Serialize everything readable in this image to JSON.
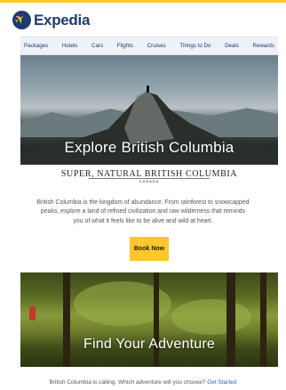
{
  "brand": {
    "name": "Expedia"
  },
  "nav": {
    "items": [
      "Packages",
      "Hotels",
      "Cars",
      "Flights",
      "Cruises",
      "Things to Do",
      "Deals",
      "Rewards"
    ]
  },
  "hero1": {
    "title": "Explore British Columbia"
  },
  "partner_logo": {
    "text": "SUPER, NATURAL BRITISH COLUMBIA",
    "subtext": "CANADA"
  },
  "body": {
    "lines": [
      "British Columbia is the kingdom of abundance. From rainforest to snowcapped",
      "peaks, explore a land of refined civilization and raw wilderness that reminds",
      "you of what it feels like to be alive and wild at heart."
    ]
  },
  "cta": {
    "label": "Book Now"
  },
  "hero2": {
    "title": "Find Your Adventure"
  },
  "footer": {
    "text": "British Columbia is calling. Which adventure will you choose?",
    "link": "Get Started"
  },
  "colors": {
    "accent": "#ffc72c",
    "brand_navy": "#1d3b6d",
    "link": "#2a68b8"
  }
}
